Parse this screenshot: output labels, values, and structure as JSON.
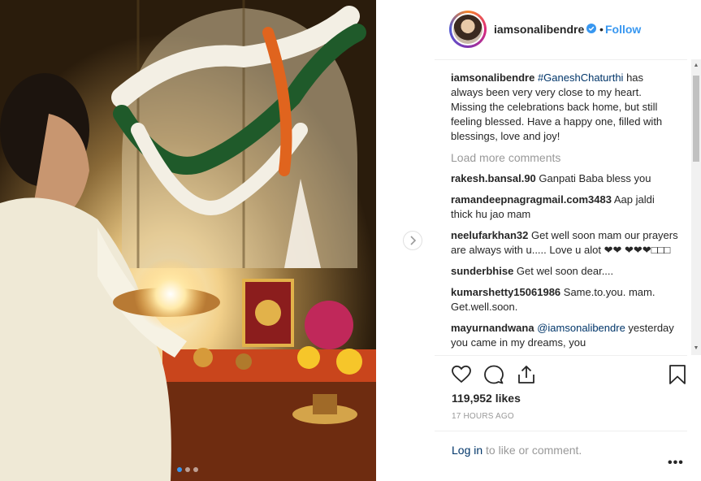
{
  "post": {
    "username": "iamsonalibendre",
    "follow_label": "Follow",
    "follow_separator": "•",
    "caption_username": "iamsonalibendre",
    "caption_hashtag": "#GaneshChaturthi",
    "caption_text": " has always been very very close to my heart. Missing the celebrations back home, but still feeling blessed. Have a happy one, filled with blessings, love and joy!",
    "load_more": "Load more comments",
    "likes": "119,952 likes",
    "time": "17 HOURS AGO",
    "login_link": "Log in",
    "login_text": " to like or comment.",
    "more_label": "•••"
  },
  "comments": [
    {
      "user": "rakesh.bansal.90",
      "text": " Ganpati Baba bless you"
    },
    {
      "user": "ramandeepnagragmail.com3483",
      "text": " Aap jaldi thick hu jao mam"
    },
    {
      "user": "neelufarkhan32",
      "text": " Get well soon mam our prayers are always with u..... Love u alot ❤❤ ❤❤❤□□□"
    },
    {
      "user": "sunderbhise",
      "text": " Get wel soon dear...."
    },
    {
      "user": "kumarshetty15061986",
      "text": " Same.to.you. mam. Get.well.soon."
    },
    {
      "user": "mayurnandwana",
      "mention": "@iamsonalibendre",
      "text": " yesterday you came in my dreams, you"
    }
  ],
  "icons": {
    "verified": "verified-badge-icon",
    "like": "heart-icon",
    "comment": "comment-bubble-icon",
    "share": "share-icon",
    "save": "bookmark-icon",
    "next": "chevron-right-icon"
  },
  "colors": {
    "link_blue": "#3897f0",
    "hashtag": "#003569",
    "muted": "#999999"
  },
  "carousel": {
    "count": 3,
    "active_index": 0
  }
}
